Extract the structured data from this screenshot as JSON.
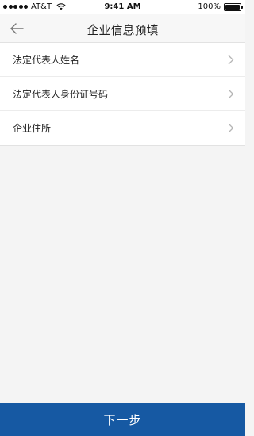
{
  "status_bar": {
    "carrier": "AT&T",
    "time": "9:41 AM",
    "battery": "100%",
    "signal_icon": "signal-dots-icon",
    "wifi_icon": "wifi-icon",
    "battery_icon": "battery-icon"
  },
  "nav": {
    "title": "企业信息预填",
    "back_icon": "back-arrow-icon"
  },
  "list": {
    "items": [
      {
        "label": "法定代表人姓名"
      },
      {
        "label": "法定代表人身份证号码"
      },
      {
        "label": "企业住所"
      }
    ],
    "chevron_icon": "chevron-right-icon"
  },
  "footer": {
    "next_label": "下一步"
  },
  "colors": {
    "primary": "#1659a3",
    "background": "#f4f4f4",
    "nav_background": "#f7f7f7"
  }
}
